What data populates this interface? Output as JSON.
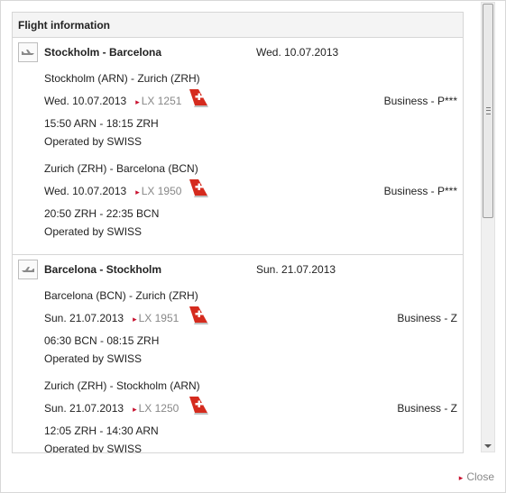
{
  "dialog": {
    "title": "Flight information",
    "close_label": "Close"
  },
  "icons": {
    "plane": "plane-icon",
    "airline": "swiss-tail-logo",
    "arrow": "red-arrow-icon"
  },
  "colors": {
    "accent_red": "#c8102e",
    "muted_text": "#888888",
    "border": "#d6d6d6"
  },
  "flights": [
    {
      "route": "Stockholm - Barcelona",
      "date": "Wed. 10.07.2013",
      "direction": "outbound",
      "segments": [
        {
          "route": "Stockholm (ARN) - Zurich (ZRH)",
          "date": "Wed. 10.07.2013",
          "flight_number": "LX 1251",
          "cabin": "Business - P***",
          "times": "15:50 ARN - 18:15 ZRH",
          "operator": "Operated by SWISS"
        },
        {
          "route": "Zurich (ZRH) - Barcelona (BCN)",
          "date": "Wed. 10.07.2013",
          "flight_number": "LX 1950",
          "cabin": "Business - P***",
          "times": "20:50 ZRH - 22:35 BCN",
          "operator": "Operated by SWISS"
        }
      ]
    },
    {
      "route": "Barcelona - Stockholm",
      "date": "Sun. 21.07.2013",
      "direction": "return",
      "segments": [
        {
          "route": "Barcelona (BCN) - Zurich (ZRH)",
          "date": "Sun. 21.07.2013",
          "flight_number": "LX 1951",
          "cabin": "Business - Z",
          "times": "06:30 BCN - 08:15 ZRH",
          "operator": "Operated by SWISS"
        },
        {
          "route": "Zurich (ZRH) - Stockholm (ARN)",
          "date": "Sun. 21.07.2013",
          "flight_number": "LX 1250",
          "cabin": "Business - Z",
          "times": "12:05 ZRH - 14:30 ARN",
          "operator": "Operated by SWISS"
        }
      ]
    }
  ]
}
